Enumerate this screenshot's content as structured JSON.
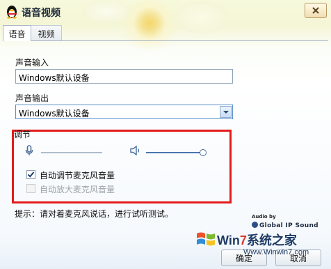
{
  "window": {
    "title": "语音视频"
  },
  "tabs": [
    {
      "label": "语音",
      "active": true
    },
    {
      "label": "视频",
      "active": false
    }
  ],
  "input": {
    "label": "声音输入",
    "value": "Windows默认设备"
  },
  "output": {
    "label": "声音输出",
    "value": "Windows默认设备"
  },
  "adjust": {
    "label": "调节",
    "mic_volume": 0.0,
    "speaker_volume": 1.0,
    "auto_adjust_label": "自动调节麦克风音量",
    "auto_adjust_checked": true,
    "auto_amplify_label": "自动放大麦克风音量",
    "auto_amplify_checked": false
  },
  "hint": "提示：请对着麦克风说话，进行试听测试。",
  "branding": {
    "audio_by": "Audio by",
    "name": "Global IP Sound"
  },
  "buttons": {
    "ok": "确定",
    "cancel": "取消"
  },
  "watermark": {
    "brand_prefix": "Win",
    "brand_seven": "7",
    "brand_suffix": "系统之家",
    "url": "Www.Winwin7.com"
  },
  "colors": {
    "highlight": "#e31b1b",
    "accent": "#4a76ad"
  }
}
